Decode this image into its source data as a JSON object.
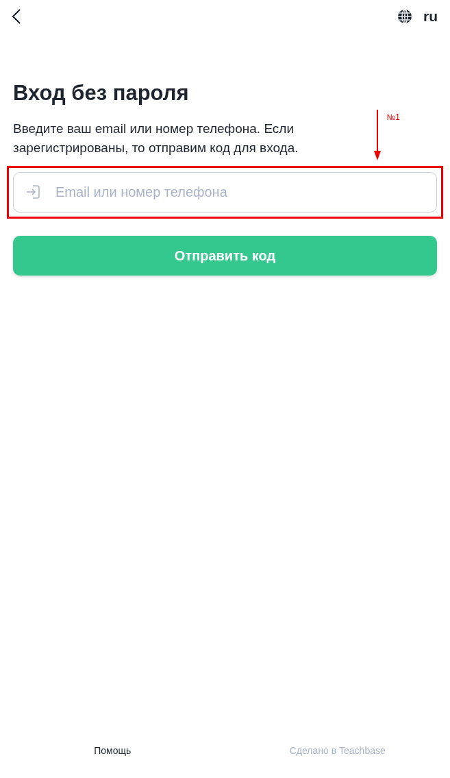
{
  "header": {
    "language": "ru"
  },
  "title": "Вход без пароля",
  "description": "Введите ваш email или номер телефона. Если зарегистрированы, то отправим код для входа.",
  "annotation": {
    "label": "№1"
  },
  "field": {
    "placeholder": "Email или номер телефона"
  },
  "submit_button": "Отправить код",
  "footer": {
    "help_link": "Помощь",
    "credit": "Сделано в Teachbase"
  }
}
